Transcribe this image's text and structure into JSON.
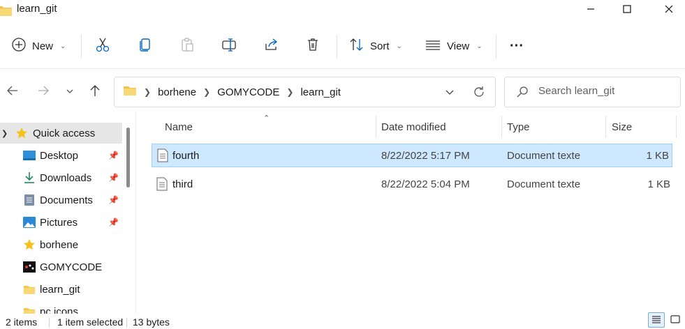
{
  "window": {
    "title": "learn_git"
  },
  "toolbar": {
    "new_label": "New",
    "sort_label": "Sort",
    "view_label": "View",
    "more_label": "···"
  },
  "address": {
    "crumbs": [
      "borhene",
      "GOMYCODE",
      "learn_git"
    ]
  },
  "search": {
    "placeholder": "Search learn_git"
  },
  "sidebar": {
    "items": [
      {
        "label": "Quick access",
        "icon": "star-icon"
      },
      {
        "label": "Desktop",
        "icon": "desktop-icon",
        "pinned": true
      },
      {
        "label": "Downloads",
        "icon": "download-icon",
        "pinned": true
      },
      {
        "label": "Documents",
        "icon": "documents-icon",
        "pinned": true
      },
      {
        "label": "Pictures",
        "icon": "pictures-icon",
        "pinned": true
      },
      {
        "label": "borhene",
        "icon": "star-icon"
      },
      {
        "label": "GOMYCODE",
        "icon": "gomycode-logo-icon"
      },
      {
        "label": "learn_git",
        "icon": "folder-icon"
      },
      {
        "label": "pc icons",
        "icon": "folder-icon"
      }
    ]
  },
  "files": {
    "columns": [
      "Name",
      "Date modified",
      "Type",
      "Size"
    ],
    "rows": [
      {
        "name": "fourth",
        "date": "8/22/2022 5:17 PM",
        "type": "Document texte",
        "size": "1 KB",
        "selected": true
      },
      {
        "name": "third",
        "date": "8/22/2022 5:04 PM",
        "type": "Document texte",
        "size": "1 KB",
        "selected": false
      }
    ]
  },
  "status": {
    "items_count": "2 items",
    "selected": "1 item selected",
    "size": "13 bytes"
  },
  "colors": {
    "accent": "#0067c0",
    "selection_bg": "#cde8ff",
    "selection_border": "#99d1ff",
    "folder": "#f3c343"
  }
}
